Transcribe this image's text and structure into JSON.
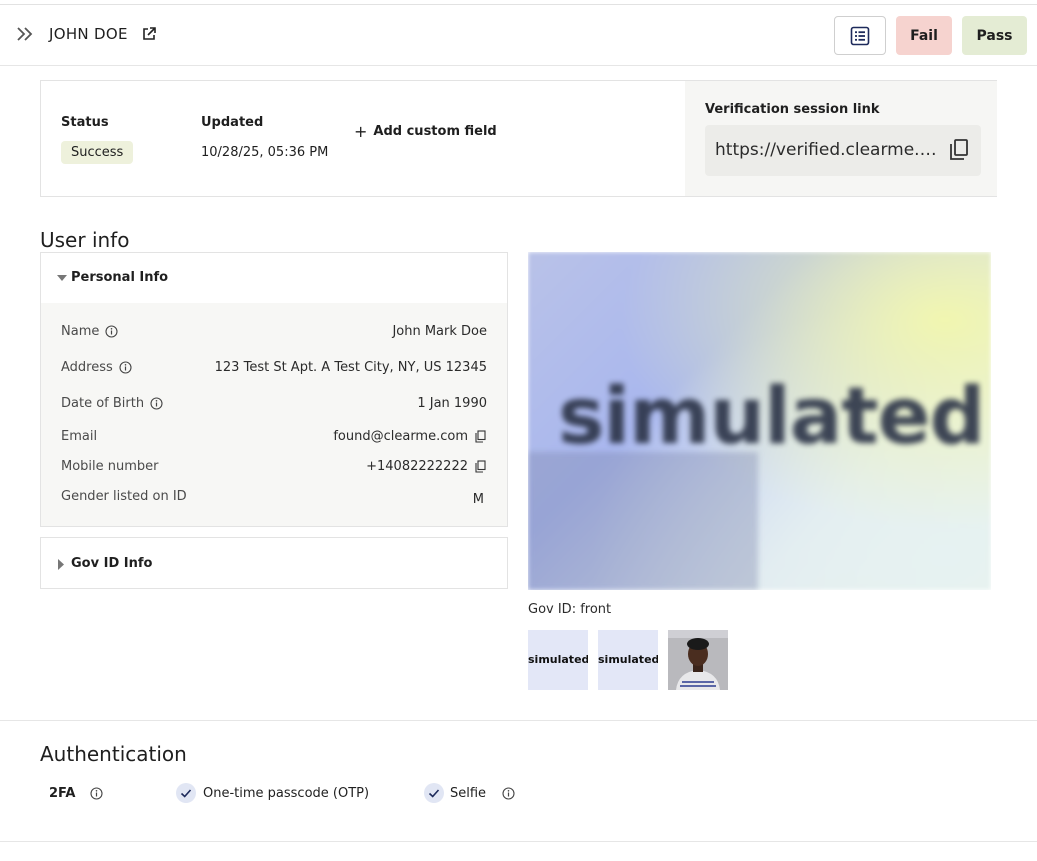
{
  "header": {
    "user_name": "JOHN DOE",
    "fail_label": "Fail",
    "pass_label": "Pass",
    "fail_color": "#f6d3cf",
    "pass_color": "#e4ecd4"
  },
  "status_card": {
    "status_label": "Status",
    "status_value": "Success",
    "updated_label": "Updated",
    "updated_value": "10/28/25, 05:36 PM",
    "add_field_label": "Add custom field",
    "session_link_label": "Verification session link",
    "session_link_value": "https://verified.clearme.com/"
  },
  "user_info": {
    "title": "User info",
    "personal": {
      "title": "Personal Info",
      "rows": [
        {
          "label": "Name",
          "value": "John Mark Doe"
        },
        {
          "label": "Address",
          "value": "123 Test St Apt. A Test City, NY, US 12345"
        },
        {
          "label": "Date of Birth",
          "value": "1 Jan 1990"
        },
        {
          "label": "Email",
          "value": "found@clearme.com"
        },
        {
          "label": "Mobile number",
          "value": "+14082222222"
        },
        {
          "label": "Gender listed on ID",
          "value": "M"
        }
      ]
    },
    "gov": {
      "title": "Gov ID Info"
    },
    "id_image_text": "simulated",
    "id_caption": "Gov ID: front",
    "thumbs": [
      "simulated",
      "simulated"
    ]
  },
  "authentication": {
    "title": "Authentication",
    "fa_label": "2FA",
    "otp_label": "One-time passcode (OTP)",
    "selfie_label": "Selfie"
  }
}
